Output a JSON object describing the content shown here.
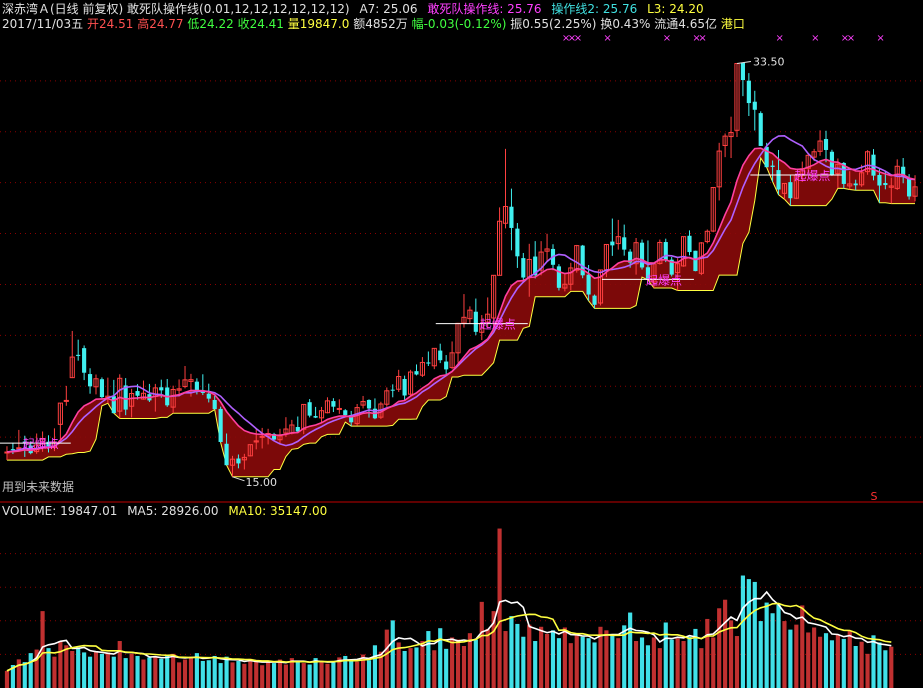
{
  "header": {
    "stock_name": "深赤湾Ａ(日线 前复权)",
    "indicator_call": "敢死队操作线(0.01,12,12,12,12,12,12)",
    "a7": "A7: 25.06",
    "line1": "敢死队操作线: 25.76",
    "line2": "操作线2: 25.76",
    "l3": "L3: 24.20",
    "date": "2017/11/03五",
    "open": "开24.51",
    "high": "高24.77",
    "low": "低24.22",
    "close": "收24.41",
    "volume": "量19847.0",
    "amount": "额4852万",
    "change": "幅-0.03(-0.12%)",
    "amplitude": "振0.55(2.25%)",
    "turnover": "换0.43%",
    "float_cap": "流通4.65亿",
    "tag": "港口"
  },
  "volume_header": {
    "volume": "VOLUME: 19847.01",
    "ma5": "MA5: 28926.00",
    "ma10": "MA10: 35147.00"
  },
  "annotations": {
    "max_price": "33.50",
    "min_price": "15.00",
    "future_note": "用到未来数据",
    "signal_label": "起爆点",
    "s_marker": "S",
    "x_marker": "×"
  },
  "colors": {
    "up": "#ff4040",
    "down": "#40f0f0",
    "ma_magenta": "#ff40a0",
    "ma_purple": "#b060ff",
    "band_fill": "#8a0a0a",
    "band_edge": "#ffff40",
    "separator": "#c00000",
    "grid": "#8a0000",
    "signal": "#ff40ff",
    "vol_ma5": "#ffffff",
    "vol_ma10": "#ffff40"
  },
  "chart_data": {
    "type": "candlestick",
    "price_range": [
      14.5,
      35.0
    ],
    "signals_at": [
      3,
      80,
      108,
      133
    ],
    "x_markers_at": [
      94,
      95,
      96,
      101,
      111,
      116,
      117,
      130,
      136,
      141,
      142,
      147
    ],
    "ohlc": [
      [
        16.11,
        16.37,
        15.75,
        16.11
      ],
      [
        16.24,
        16.52,
        16.02,
        16.2
      ],
      [
        16.26,
        17.1,
        16.17,
        16.3
      ],
      [
        16.58,
        16.84,
        15.89,
        16.51
      ],
      [
        16.4,
        16.59,
        16.01,
        16.06
      ],
      [
        16.13,
        16.94,
        16.03,
        16.43
      ],
      [
        16.33,
        17.03,
        16.12,
        16.71
      ],
      [
        16.57,
        16.86,
        16.09,
        16.37
      ],
      [
        16.31,
        17.17,
        16.15,
        16.54
      ],
      [
        17.35,
        18.3,
        16.69,
        18.3
      ],
      [
        18.42,
        19.07,
        18.18,
        18.42
      ],
      [
        19.44,
        21.53,
        19.42,
        20.36
      ],
      [
        20.46,
        21.14,
        20.2,
        20.41
      ],
      [
        20.76,
        20.88,
        19.33,
        19.66
      ],
      [
        19.6,
        19.86,
        18.72,
        19.05
      ],
      [
        19.03,
        19.58,
        18.69,
        19.39
      ],
      [
        19.37,
        19.45,
        18.52,
        18.57
      ],
      [
        18.55,
        19.44,
        18.29,
        18.61
      ],
      [
        18.61,
        19.34,
        17.85,
        17.85
      ],
      [
        17.94,
        19.59,
        17.61,
        19.41
      ],
      [
        19.09,
        19.42,
        17.76,
        18.01
      ],
      [
        18.16,
        18.94,
        17.66,
        18.73
      ],
      [
        18.84,
        19.15,
        18.46,
        18.63
      ],
      [
        18.48,
        19.31,
        18.45,
        18.74
      ],
      [
        18.7,
        19.16,
        18.35,
        18.42
      ],
      [
        18.6,
        19.16,
        17.92,
        18.98
      ],
      [
        19.01,
        19.35,
        18.54,
        18.87
      ],
      [
        19.0,
        19.38,
        18.13,
        18.2
      ],
      [
        18.12,
        19.08,
        17.85,
        18.91
      ],
      [
        18.88,
        19.36,
        18.59,
        18.94
      ],
      [
        19.04,
        19.96,
        18.96,
        19.34
      ],
      [
        19.27,
        19.61,
        18.59,
        19.35
      ],
      [
        19.26,
        19.41,
        18.69,
        18.85
      ],
      [
        18.8,
        19.59,
        18.66,
        18.79
      ],
      [
        18.72,
        19.17,
        18.33,
        18.5
      ],
      [
        18.44,
        18.63,
        18.01,
        18.03
      ],
      [
        18.04,
        18.14,
        16.54,
        16.56
      ],
      [
        16.48,
        16.94,
        15.52,
        15.52
      ],
      [
        15.52,
        15.94,
        15.0,
        15.79
      ],
      [
        15.82,
        16.0,
        15.38,
        15.6
      ],
      [
        15.76,
        16.03,
        15.33,
        15.87
      ],
      [
        15.94,
        16.44,
        15.91,
        16.44
      ],
      [
        16.56,
        17.14,
        16.23,
        16.61
      ],
      [
        16.77,
        17.19,
        16.27,
        16.81
      ],
      [
        16.81,
        17.15,
        16.45,
        16.94
      ],
      [
        16.92,
        16.97,
        16.61,
        16.67
      ],
      [
        16.66,
        17.15,
        16.51,
        16.83
      ],
      [
        16.96,
        17.67,
        16.79,
        17.14
      ],
      [
        16.95,
        17.55,
        16.9,
        17.32
      ],
      [
        17.23,
        17.7,
        16.96,
        17.03
      ],
      [
        17.13,
        18.24,
        16.91,
        18.24
      ],
      [
        18.34,
        18.48,
        17.66,
        17.74
      ],
      [
        17.72,
        18.13,
        17.63,
        17.65
      ],
      [
        17.64,
        18.13,
        17.45,
        17.96
      ],
      [
        17.87,
        18.56,
        17.84,
        18.4
      ],
      [
        18.39,
        18.52,
        17.9,
        18.14
      ],
      [
        18.03,
        18.47,
        17.82,
        18.06
      ],
      [
        17.98,
        18.03,
        17.66,
        17.76
      ],
      [
        17.76,
        17.95,
        17.27,
        17.44
      ],
      [
        17.39,
        18.26,
        17.3,
        18.1
      ],
      [
        18.21,
        18.62,
        18.06,
        18.37
      ],
      [
        18.44,
        18.47,
        17.65,
        18.06
      ],
      [
        18.05,
        18.51,
        17.58,
        17.62
      ],
      [
        17.67,
        18.36,
        17.59,
        18.26
      ],
      [
        18.25,
        19.0,
        18.14,
        18.85
      ],
      [
        18.9,
        19.14,
        18.56,
        18.88
      ],
      [
        18.92,
        19.79,
        18.8,
        19.49
      ],
      [
        19.38,
        19.53,
        18.44,
        18.64
      ],
      [
        18.7,
        19.79,
        18.59,
        19.69
      ],
      [
        19.73,
        20.03,
        19.54,
        19.58
      ],
      [
        19.55,
        20.36,
        19.47,
        20.12
      ],
      [
        20.12,
        20.61,
        19.96,
        20.07
      ],
      [
        19.97,
        20.76,
        19.82,
        20.75
      ],
      [
        20.65,
        20.96,
        20.09,
        20.22
      ],
      [
        20.16,
        20.45,
        19.55,
        19.81
      ],
      [
        19.89,
        21.06,
        19.82,
        20.55
      ],
      [
        20.55,
        21.89,
        20.11,
        21.87
      ],
      [
        21.88,
        23.18,
        21.68,
        22.14
      ],
      [
        22.08,
        22.63,
        21.88,
        22.46
      ],
      [
        22.39,
        22.98,
        21.34,
        21.49
      ],
      [
        21.47,
        22.24,
        21.12,
        21.86
      ],
      [
        21.92,
        23.03,
        21.65,
        22.28
      ],
      [
        22.11,
        24.02,
        21.73,
        24.02
      ],
      [
        24.02,
        27.06,
        24.0,
        26.44
      ],
      [
        26.35,
        29.68,
        26.12,
        27.1
      ],
      [
        27.09,
        27.9,
        25.14,
        26.14
      ],
      [
        26.11,
        26.36,
        24.35,
        24.87
      ],
      [
        24.79,
        25.02,
        23.69,
        23.92
      ],
      [
        23.94,
        25.43,
        23.06,
        24.73
      ],
      [
        24.86,
        25.55,
        23.88,
        24.02
      ],
      [
        24.25,
        25.55,
        24.02,
        25.06
      ],
      [
        25.1,
        25.88,
        24.64,
        25.2
      ],
      [
        25.2,
        25.41,
        24.25,
        24.49
      ],
      [
        24.42,
        24.52,
        23.34,
        23.46
      ],
      [
        23.45,
        24.13,
        23.3,
        23.62
      ],
      [
        23.62,
        24.58,
        23.35,
        24.35
      ],
      [
        24.25,
        25.38,
        24.14,
        25.35
      ],
      [
        25.35,
        25.38,
        23.89,
        24.02
      ],
      [
        24.05,
        24.48,
        22.88,
        23.16
      ],
      [
        23.11,
        23.16,
        22.54,
        22.7
      ],
      [
        22.78,
        24.26,
        22.67,
        24.26
      ],
      [
        24.27,
        25.4,
        23.94,
        25.4
      ],
      [
        25.53,
        26.56,
        24.89,
        25.36
      ],
      [
        25.44,
        26.5,
        25.17,
        25.75
      ],
      [
        25.72,
        26.29,
        24.9,
        25.17
      ],
      [
        25.08,
        25.19,
        24.36,
        24.59
      ],
      [
        24.54,
        25.69,
        24.05,
        25.48
      ],
      [
        25.48,
        25.62,
        24.28,
        24.37
      ],
      [
        24.38,
        25.58,
        23.81,
        23.84
      ],
      [
        23.72,
        24.59,
        23.45,
        24.53
      ],
      [
        24.55,
        25.62,
        24.5,
        25.49
      ],
      [
        25.51,
        25.66,
        24.61,
        24.71
      ],
      [
        24.72,
        24.84,
        23.97,
        24.05
      ],
      [
        24.14,
        24.78,
        23.34,
        24.54
      ],
      [
        24.44,
        25.75,
        24.4,
        25.75
      ],
      [
        25.79,
        26.03,
        24.91,
        25.06
      ],
      [
        25.12,
        25.12,
        24.2,
        24.21
      ],
      [
        24.11,
        25.51,
        24.03,
        25.47
      ],
      [
        25.53,
        26.07,
        25.45,
        25.99
      ],
      [
        26.0,
        27.95,
        25.95,
        27.95
      ],
      [
        27.98,
        29.95,
        27.37,
        29.58
      ],
      [
        29.83,
        30.37,
        29.31,
        30.25
      ],
      [
        30.23,
        31.12,
        29.27,
        30.41
      ],
      [
        30.51,
        33.5,
        30.21,
        33.5
      ],
      [
        33.54,
        33.36,
        32.04,
        32.76
      ],
      [
        32.73,
        33.07,
        31.15,
        31.73
      ],
      [
        31.79,
        32.28,
        30.5,
        31.43
      ],
      [
        31.28,
        31.36,
        29.81,
        29.81
      ],
      [
        29.77,
        29.95,
        28.85,
        28.86
      ],
      [
        28.93,
        29.16,
        28.21,
        28.87
      ],
      [
        28.73,
        29.63,
        27.63,
        27.86
      ],
      [
        27.69,
        28.15,
        27.42,
        28.13
      ],
      [
        28.19,
        28.51,
        27.14,
        27.47
      ],
      [
        27.47,
        28.54,
        27.43,
        28.51
      ],
      [
        28.5,
        29.11,
        28.2,
        28.79
      ],
      [
        28.81,
        29.48,
        28.62,
        29.39
      ],
      [
        29.31,
        29.68,
        29.13,
        29.55
      ],
      [
        29.57,
        30.51,
        29.37,
        30.03
      ],
      [
        30.12,
        30.49,
        29.08,
        29.63
      ],
      [
        29.55,
        29.64,
        28.47,
        28.51
      ],
      [
        28.57,
        29.25,
        27.92,
        28.99
      ],
      [
        29.05,
        29.09,
        27.91,
        28.11
      ],
      [
        28.02,
        28.68,
        27.86,
        28.11
      ],
      [
        28.13,
        28.3,
        27.83,
        28.05
      ],
      [
        28.07,
        28.97,
        27.98,
        28.61
      ],
      [
        28.66,
        29.62,
        28.52,
        29.55
      ],
      [
        29.42,
        29.67,
        28.27,
        28.48
      ],
      [
        28.51,
        28.77,
        27.27,
        28.04
      ],
      [
        28.15,
        28.68,
        27.87,
        28.06
      ],
      [
        27.96,
        28.39,
        27.23,
        28.02
      ],
      [
        27.91,
        29.21,
        27.84,
        28.9
      ],
      [
        28.88,
        29.27,
        28.14,
        28.43
      ],
      [
        28.33,
        28.55,
        27.41,
        27.55
      ],
      [
        27.56,
        28.5,
        27.33,
        27.98
      ]
    ],
    "volume": [
      12008,
      16155,
      20128,
      18200,
      24500,
      27000,
      54000,
      28000,
      22000,
      33000,
      30000,
      26000,
      28500,
      25000,
      22000,
      26000,
      24000,
      25000,
      22000,
      33000,
      21000,
      24000,
      22500,
      20000,
      21500,
      22000,
      20500,
      23000,
      24000,
      18000,
      20000,
      22000,
      24500,
      19000,
      19500,
      22500,
      17500,
      22000,
      18000,
      19000,
      17000,
      20500,
      18500,
      16000,
      19000,
      17500,
      20000,
      16500,
      21000,
      19000,
      17500,
      16500,
      21000,
      19000,
      17000,
      18000,
      21500,
      22500,
      20000,
      18500,
      23500,
      19500,
      30000,
      25500,
      41000,
      47500,
      32000,
      26000,
      28000,
      28500,
      33000,
      40000,
      26500,
      42000,
      27500,
      35500,
      34000,
      29500,
      38500,
      34000,
      60500,
      41500,
      54000,
      112000,
      40000,
      50500,
      45000,
      36000,
      44500,
      33000,
      43000,
      38000,
      40500,
      35000,
      42500,
      31500,
      37500,
      36000,
      35000,
      32000,
      43000,
      40500,
      37000,
      35000,
      44000,
      53000,
      33000,
      35500,
      30000,
      35500,
      28000,
      46000,
      34000,
      35000,
      33000,
      36000,
      41500,
      28000,
      48500,
      35500,
      56000,
      62000,
      47500,
      36500,
      79000,
      76500,
      74500,
      47000,
      60000,
      52500,
      58500,
      47000,
      41000,
      44500,
      58000,
      39000,
      42500,
      36000,
      38500,
      33500,
      37500,
      34500,
      40000,
      29500,
      32500,
      24000,
      37000,
      32000,
      26500,
      29000
    ],
    "vol_range": [
      0,
      118000
    ]
  }
}
